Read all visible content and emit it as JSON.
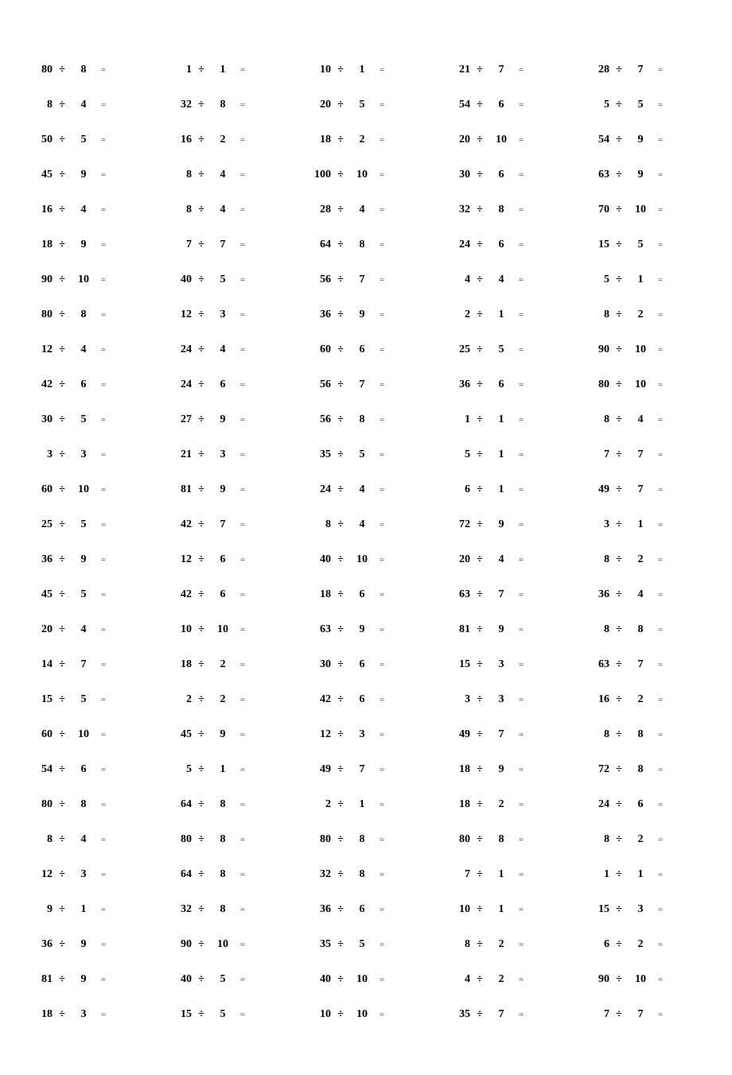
{
  "operator": "÷",
  "equals": "=",
  "rows": [
    [
      {
        "a": 80,
        "b": 8
      },
      {
        "a": 1,
        "b": 1
      },
      {
        "a": 10,
        "b": 1
      },
      {
        "a": 21,
        "b": 7
      },
      {
        "a": 28,
        "b": 7
      }
    ],
    [
      {
        "a": 8,
        "b": 4
      },
      {
        "a": 32,
        "b": 8
      },
      {
        "a": 20,
        "b": 5
      },
      {
        "a": 54,
        "b": 6
      },
      {
        "a": 5,
        "b": 5
      }
    ],
    [
      {
        "a": 50,
        "b": 5
      },
      {
        "a": 16,
        "b": 2
      },
      {
        "a": 18,
        "b": 2
      },
      {
        "a": 20,
        "b": 10
      },
      {
        "a": 54,
        "b": 9
      }
    ],
    [
      {
        "a": 45,
        "b": 9
      },
      {
        "a": 8,
        "b": 4
      },
      {
        "a": 100,
        "b": 10
      },
      {
        "a": 30,
        "b": 6
      },
      {
        "a": 63,
        "b": 9
      }
    ],
    [
      {
        "a": 16,
        "b": 4
      },
      {
        "a": 8,
        "b": 4
      },
      {
        "a": 28,
        "b": 4
      },
      {
        "a": 32,
        "b": 8
      },
      {
        "a": 70,
        "b": 10
      }
    ],
    [
      {
        "a": 18,
        "b": 9
      },
      {
        "a": 7,
        "b": 7
      },
      {
        "a": 64,
        "b": 8
      },
      {
        "a": 24,
        "b": 6
      },
      {
        "a": 15,
        "b": 5
      }
    ],
    [
      {
        "a": 90,
        "b": 10
      },
      {
        "a": 40,
        "b": 5
      },
      {
        "a": 56,
        "b": 7
      },
      {
        "a": 4,
        "b": 4
      },
      {
        "a": 5,
        "b": 1
      }
    ],
    [
      {
        "a": 80,
        "b": 8
      },
      {
        "a": 12,
        "b": 3
      },
      {
        "a": 36,
        "b": 9
      },
      {
        "a": 2,
        "b": 1
      },
      {
        "a": 8,
        "b": 2
      }
    ],
    [
      {
        "a": 12,
        "b": 4
      },
      {
        "a": 24,
        "b": 4
      },
      {
        "a": 60,
        "b": 6
      },
      {
        "a": 25,
        "b": 5
      },
      {
        "a": 90,
        "b": 10
      }
    ],
    [
      {
        "a": 42,
        "b": 6
      },
      {
        "a": 24,
        "b": 6
      },
      {
        "a": 56,
        "b": 7
      },
      {
        "a": 36,
        "b": 6
      },
      {
        "a": 80,
        "b": 10
      }
    ],
    [
      {
        "a": 30,
        "b": 5
      },
      {
        "a": 27,
        "b": 9
      },
      {
        "a": 56,
        "b": 8
      },
      {
        "a": 1,
        "b": 1
      },
      {
        "a": 8,
        "b": 4
      }
    ],
    [
      {
        "a": 3,
        "b": 3
      },
      {
        "a": 21,
        "b": 3
      },
      {
        "a": 35,
        "b": 5
      },
      {
        "a": 5,
        "b": 1
      },
      {
        "a": 7,
        "b": 7
      }
    ],
    [
      {
        "a": 60,
        "b": 10
      },
      {
        "a": 81,
        "b": 9
      },
      {
        "a": 24,
        "b": 4
      },
      {
        "a": 6,
        "b": 1
      },
      {
        "a": 49,
        "b": 7
      }
    ],
    [
      {
        "a": 25,
        "b": 5
      },
      {
        "a": 42,
        "b": 7
      },
      {
        "a": 8,
        "b": 4
      },
      {
        "a": 72,
        "b": 9
      },
      {
        "a": 3,
        "b": 1
      }
    ],
    [
      {
        "a": 36,
        "b": 9
      },
      {
        "a": 12,
        "b": 6
      },
      {
        "a": 40,
        "b": 10
      },
      {
        "a": 20,
        "b": 4
      },
      {
        "a": 8,
        "b": 2
      }
    ],
    [
      {
        "a": 45,
        "b": 5
      },
      {
        "a": 42,
        "b": 6
      },
      {
        "a": 18,
        "b": 6
      },
      {
        "a": 63,
        "b": 7
      },
      {
        "a": 36,
        "b": 4
      }
    ],
    [
      {
        "a": 20,
        "b": 4
      },
      {
        "a": 10,
        "b": 10
      },
      {
        "a": 63,
        "b": 9
      },
      {
        "a": 81,
        "b": 9
      },
      {
        "a": 8,
        "b": 8
      }
    ],
    [
      {
        "a": 14,
        "b": 7
      },
      {
        "a": 18,
        "b": 2
      },
      {
        "a": 30,
        "b": 6
      },
      {
        "a": 15,
        "b": 3
      },
      {
        "a": 63,
        "b": 7
      }
    ],
    [
      {
        "a": 15,
        "b": 5
      },
      {
        "a": 2,
        "b": 2
      },
      {
        "a": 42,
        "b": 6
      },
      {
        "a": 3,
        "b": 3
      },
      {
        "a": 16,
        "b": 2
      }
    ],
    [
      {
        "a": 60,
        "b": 10
      },
      {
        "a": 45,
        "b": 9
      },
      {
        "a": 12,
        "b": 3
      },
      {
        "a": 49,
        "b": 7
      },
      {
        "a": 8,
        "b": 8
      }
    ],
    [
      {
        "a": 54,
        "b": 6
      },
      {
        "a": 5,
        "b": 1
      },
      {
        "a": 49,
        "b": 7
      },
      {
        "a": 18,
        "b": 9
      },
      {
        "a": 72,
        "b": 8
      }
    ],
    [
      {
        "a": 80,
        "b": 8
      },
      {
        "a": 64,
        "b": 8
      },
      {
        "a": 2,
        "b": 1
      },
      {
        "a": 18,
        "b": 2
      },
      {
        "a": 24,
        "b": 6
      }
    ],
    [
      {
        "a": 8,
        "b": 4
      },
      {
        "a": 80,
        "b": 8
      },
      {
        "a": 80,
        "b": 8
      },
      {
        "a": 80,
        "b": 8
      },
      {
        "a": 8,
        "b": 2
      }
    ],
    [
      {
        "a": 12,
        "b": 3
      },
      {
        "a": 64,
        "b": 8
      },
      {
        "a": 32,
        "b": 8
      },
      {
        "a": 7,
        "b": 1
      },
      {
        "a": 1,
        "b": 1
      }
    ],
    [
      {
        "a": 9,
        "b": 1
      },
      {
        "a": 32,
        "b": 8
      },
      {
        "a": 36,
        "b": 6
      },
      {
        "a": 10,
        "b": 1
      },
      {
        "a": 15,
        "b": 3
      }
    ],
    [
      {
        "a": 36,
        "b": 9
      },
      {
        "a": 90,
        "b": 10
      },
      {
        "a": 35,
        "b": 5
      },
      {
        "a": 8,
        "b": 2
      },
      {
        "a": 6,
        "b": 2
      }
    ],
    [
      {
        "a": 81,
        "b": 9
      },
      {
        "a": 40,
        "b": 5
      },
      {
        "a": 40,
        "b": 10
      },
      {
        "a": 4,
        "b": 2
      },
      {
        "a": 90,
        "b": 10
      }
    ],
    [
      {
        "a": 18,
        "b": 3
      },
      {
        "a": 15,
        "b": 5
      },
      {
        "a": 10,
        "b": 10
      },
      {
        "a": 35,
        "b": 7
      },
      {
        "a": 7,
        "b": 7
      }
    ]
  ]
}
